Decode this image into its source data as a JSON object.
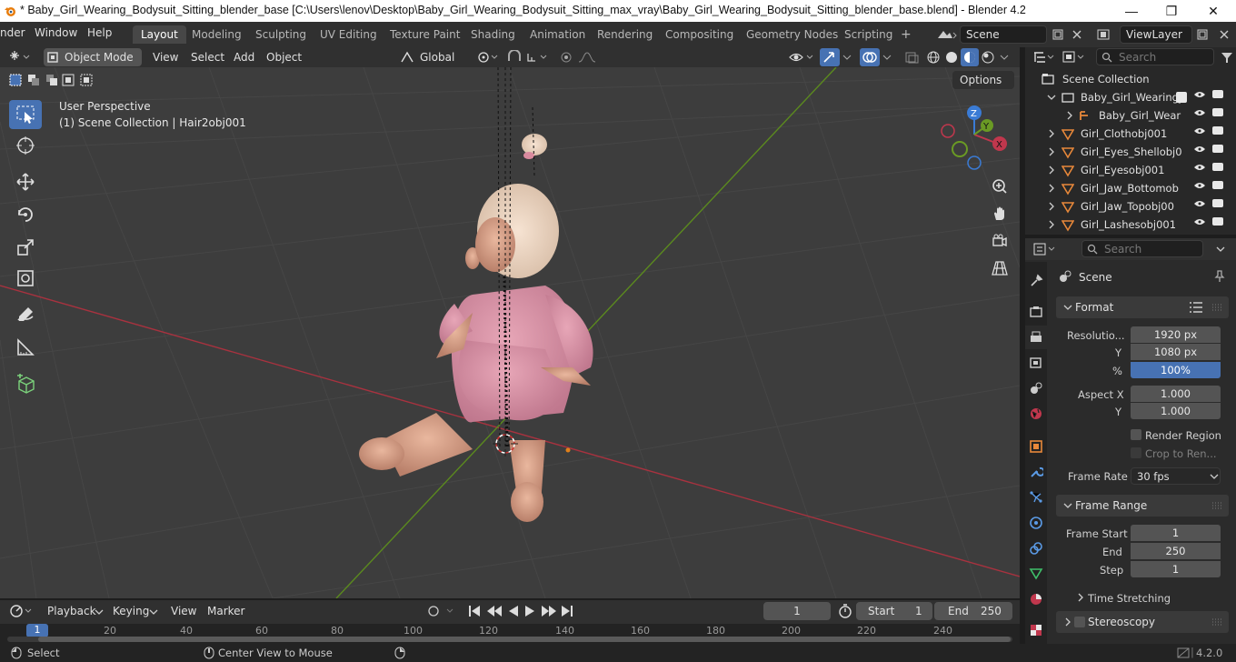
{
  "window": {
    "title": "* Baby_Girl_Wearing_Bodysuit_Sitting_blender_base [C:\\Users\\lenov\\Desktop\\Baby_Girl_Wearing_Bodysuit_Sitting_max_vray\\Baby_Girl_Wearing_Bodysuit_Sitting_blender_base.blend] - Blender 4.2",
    "minimize": "—",
    "maximize": "❐",
    "close": "✕"
  },
  "menus": [
    "nder",
    "Window",
    "Help"
  ],
  "workspaces": [
    "Layout",
    "Modeling",
    "Sculpting",
    "UV Editing",
    "Texture Paint",
    "Shading",
    "Animation",
    "Rendering",
    "Compositing",
    "Geometry Nodes",
    "Scripting"
  ],
  "workspace_add": "+",
  "scene_name": "Scene",
  "view_layer": "ViewLayer",
  "viewport_header": {
    "mode": "Object Mode",
    "view": "View",
    "select": "Select",
    "add": "Add",
    "object": "Object",
    "transform": "Global",
    "options": "Options"
  },
  "viewport": {
    "perspective": "User Perspective",
    "collection_info": "(1) Scene Collection | Hair2obj001"
  },
  "outliner": {
    "search_placeholder": "Search",
    "root": "Scene Collection",
    "items": [
      "Baby_Girl_Wearing_",
      "Baby_Girl_Wear",
      "Girl_Clothobj001",
      "Girl_Eyes_Shellobj0",
      "Girl_Eyesobj001",
      "Girl_Jaw_Bottomob",
      "Girl_Jaw_Topobj00",
      "Girl_Lashesobj001"
    ]
  },
  "properties": {
    "search_placeholder": "Search",
    "context": "Scene",
    "format": {
      "header": "Format",
      "resolution_label": "Resolutio...",
      "resolution_x": "1920 px",
      "y_label": "Y",
      "resolution_y": "1080 px",
      "pct_label": "%",
      "resolution_pct": "100%",
      "aspect_label": "Aspect X",
      "aspect_x": "1.000",
      "aspect_y": "1.000",
      "render_region": "Render Region",
      "crop": "Crop to Ren...",
      "frame_rate_label": "Frame Rate",
      "frame_rate": "30 fps"
    },
    "frame_range": {
      "header": "Frame Range",
      "start_label": "Frame Start",
      "start": "1",
      "end_label": "End",
      "end": "250",
      "step_label": "Step",
      "step": "1"
    },
    "time_stretching": "Time Stretching",
    "stereoscopy": "Stereoscopy"
  },
  "timeline": {
    "playback": "Playback",
    "keying": "Keying",
    "view": "View",
    "marker": "Marker",
    "current_frame": "1",
    "start_label": "Start",
    "start": "1",
    "end_label": "End",
    "end": "250",
    "ruler": [
      "1",
      "20",
      "40",
      "60",
      "80",
      "100",
      "120",
      "140",
      "160",
      "180",
      "200",
      "220",
      "240"
    ]
  },
  "statusbar": {
    "select": "Select",
    "center_view": "Center View to Mouse",
    "version": "4.2.0"
  },
  "colors": {
    "accent": "#4772b3",
    "x_axis": "#c0374d",
    "y_axis": "#6a9a24",
    "z_axis": "#3a7bd5",
    "outliner_object": "#e8883a"
  }
}
